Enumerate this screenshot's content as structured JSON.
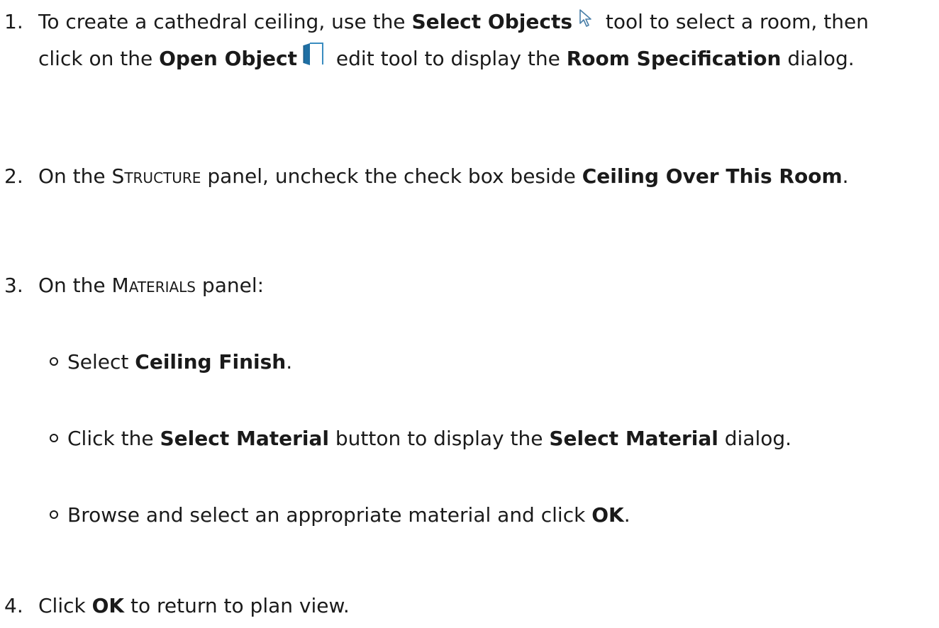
{
  "steps": [
    {
      "number": "1.",
      "line1": {
        "t1": "To create a cathedral ceiling, use the ",
        "b1": "Select Objects",
        "t2": " tool to select a room, then"
      },
      "line2": {
        "t1": "click on the ",
        "b1": "Open Object",
        "t2": " edit tool to display the ",
        "b2": "Room Specification",
        "t3": " dialog."
      }
    },
    {
      "number": "2.",
      "t1": "On the ",
      "sc": "Structure",
      "t2": " panel, uncheck the check box beside ",
      "b1": "Ceiling Over This Room",
      "t3": "."
    },
    {
      "number": "3.",
      "t1": "On the ",
      "sc": "Materials",
      "t2": " panel:",
      "subitems": [
        {
          "t1": "Select ",
          "b1": "Ceiling Finish",
          "t2": "."
        },
        {
          "t1": "Click the ",
          "b1": "Select Material",
          "t2": " button to display the ",
          "b2": "Select Material",
          "t3": " dialog."
        },
        {
          "t1": "Browse and select an appropriate material and click ",
          "b1": "OK",
          "t2": "."
        }
      ]
    },
    {
      "number": "4.",
      "t1": "Click ",
      "b1": "OK",
      "t2": " to return to plan view."
    }
  ],
  "icons": {
    "select_objects": "arrow-cursor-icon",
    "open_object": "open-door-icon"
  }
}
